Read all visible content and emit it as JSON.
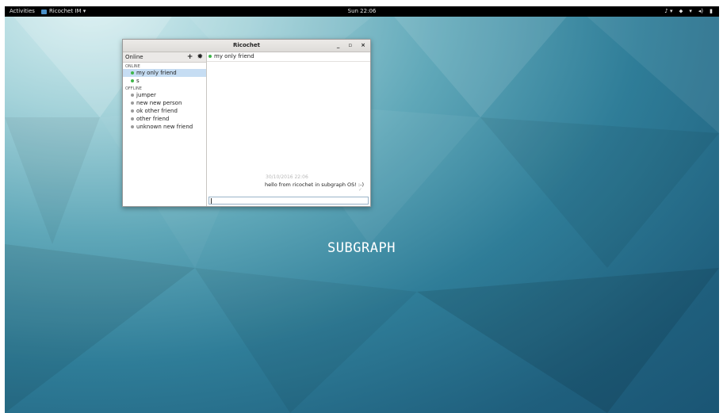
{
  "topbar": {
    "activities": "Activities",
    "app_menu": "Ricochet IM ▾",
    "clock": "Sun 22:06",
    "tray": [
      "♪ ▾",
      "⬥",
      "▾",
      "◂)",
      "▮"
    ]
  },
  "window": {
    "title": "Ricochet",
    "controls": [
      "_",
      "▫",
      "×"
    ]
  },
  "sidebar": {
    "status": "Online",
    "add_icon": "plus-icon",
    "settings_icon": "gear-icon",
    "online_label": "ONLINE",
    "online": [
      {
        "name": "my only friend",
        "selected": true
      },
      {
        "name": "s",
        "selected": false
      }
    ],
    "offline_label": "OFFLINE",
    "offline": [
      {
        "name": "jumper"
      },
      {
        "name": "new new person"
      },
      {
        "name": "ok other friend"
      },
      {
        "name": "other friend"
      },
      {
        "name": "unknown new friend"
      }
    ]
  },
  "chat": {
    "contact": "my only friend",
    "message": {
      "time": "30/10/2016 22:06",
      "text": "hello from ricochet in subgraph OS! :-)",
      "receipt": "✓"
    },
    "input_value": ""
  },
  "desktop": {
    "brand": "SUBGRAPH"
  }
}
